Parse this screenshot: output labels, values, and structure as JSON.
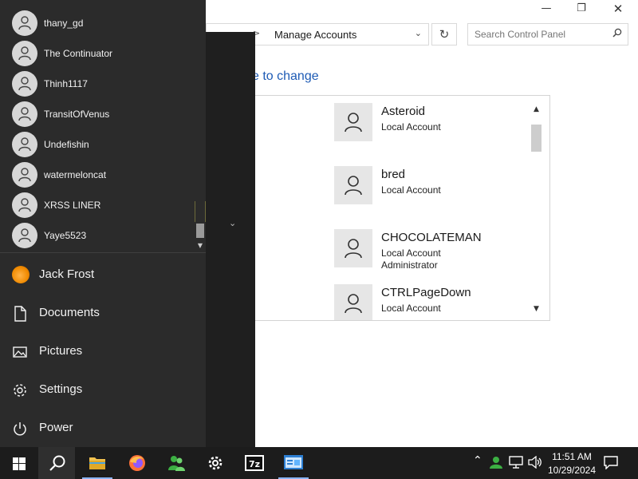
{
  "control_panel": {
    "address": {
      "separator": ">",
      "location": "Manage Accounts",
      "dropdown_icon": "chevron-down-icon"
    },
    "refresh_icon": "refresh-icon",
    "search": {
      "placeholder": "Search Control Panel",
      "icon": "search-icon"
    },
    "heading_fragment": "e to change",
    "window_controls": {
      "minimize": "—",
      "maximize": "❐",
      "close": "✕"
    },
    "accounts": [
      {
        "name": "Asteroid",
        "type": "Local Account"
      },
      {
        "name": "bred",
        "type": "Local Account"
      },
      {
        "name": "CHOCOLATEMAN",
        "type": "Local Account",
        "role": "Administrator"
      },
      {
        "name": "CTRLPageDown",
        "type": "Local Account"
      }
    ]
  },
  "start_menu": {
    "user_list": [
      {
        "name": "thany_gd"
      },
      {
        "name": "The Continuator"
      },
      {
        "name": "Thinh1117"
      },
      {
        "name": "TransitOfVenus"
      },
      {
        "name": "Undefishin"
      },
      {
        "name": "watermeloncat"
      },
      {
        "name": "XRSS LINER"
      },
      {
        "name": "Yaye5523"
      }
    ],
    "current_user": "Jack Frost",
    "items": {
      "documents": "Documents",
      "pictures": "Pictures",
      "settings": "Settings",
      "power": "Power"
    }
  },
  "taskbar": {
    "apps": [
      "start-icon",
      "search-icon",
      "file-explorer-icon",
      "firefox-icon",
      "people-icon",
      "settings-icon",
      "7zip-icon",
      "control-panel-icon"
    ],
    "clock": {
      "time": "11:51 AM",
      "date": "10/29/2024"
    },
    "tray_icons": [
      "chevron-up-icon",
      "user-icon",
      "network-icon",
      "volume-icon"
    ]
  },
  "colors": {
    "start_menu_bg": "#2b2b2b",
    "taskbar_bg": "#1c1c1c",
    "link_blue": "#1e5bb5"
  }
}
